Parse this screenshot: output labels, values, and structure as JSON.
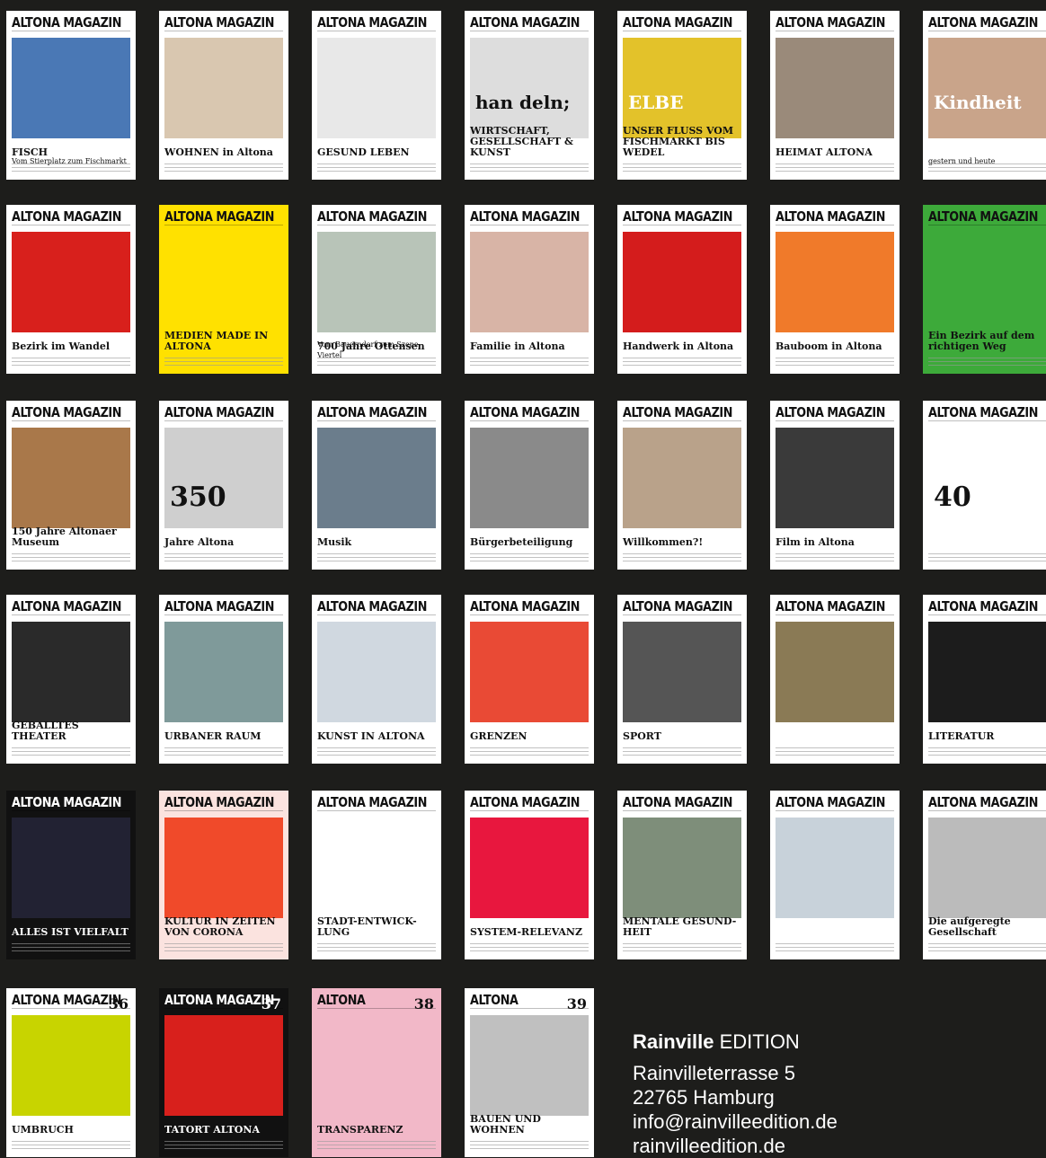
{
  "issues": [
    {
      "masthead": "ALTONA MAGAZIN",
      "headline": "FISCH",
      "sub": "Vom Stierplatz zum Fischmarkt",
      "bg": "#ffffff",
      "art": "#4a78b5"
    },
    {
      "masthead": "ALTONA MAGAZIN",
      "headline": "WOHNEN in Altona",
      "sub": "",
      "bg": "#ffffff",
      "art": "#d9c7b0"
    },
    {
      "masthead": "ALTONA MAGAZIN",
      "headline": "GESUND LEBEN",
      "sub": "",
      "bg": "#ffffff",
      "art": "#e8e8e8"
    },
    {
      "masthead": "ALTONA MAGAZIN",
      "headline": "WIRTSCHAFT, GESELLSCHAFT & KUNST",
      "sub": "",
      "bg": "#ffffff",
      "art": "#dddddd",
      "big": "han deln;"
    },
    {
      "masthead": "ALTONA MAGAZIN",
      "headline": "UNSER FLUSS VOM FISCHMARKT BIS WEDEL",
      "sub": "",
      "bg": "#ffffff",
      "art": "#e3c22a",
      "big": "ELBE"
    },
    {
      "masthead": "ALTONA MAGAZIN",
      "headline": "HEIMAT ALTONA",
      "sub": "",
      "bg": "#ffffff",
      "art": "#9a8a7a"
    },
    {
      "masthead": "ALTONA MAGAZIN",
      "headline": "",
      "sub": "gestern und heute",
      "bg": "#ffffff",
      "art": "#c9a48a",
      "big": "Kindheit"
    },
    {
      "masthead": "ALTONA MAGAZIN",
      "headline": "Bezirk im Wandel",
      "sub": "",
      "bg": "#ffffff",
      "art": "#d8201c"
    },
    {
      "masthead": "ALTONA MAGAZIN",
      "headline": "MEDIEN MADE IN ALTONA",
      "sub": "",
      "bg": "#ffe100",
      "art": "#ffe100"
    },
    {
      "masthead": "ALTONA MAGAZIN",
      "headline": "700 Jahre Ottensen",
      "sub": "Vom Bauerndorf zum Szene-Viertel",
      "bg": "#ffffff",
      "art": "#b8c4b8"
    },
    {
      "masthead": "ALTONA MAGAZIN",
      "headline": "Familie in Altona",
      "sub": "",
      "bg": "#ffffff",
      "art": "#d8b4a6"
    },
    {
      "masthead": "ALTONA MAGAZIN",
      "headline": "Handwerk in Altona",
      "sub": "",
      "bg": "#ffffff",
      "art": "#d41c1c"
    },
    {
      "masthead": "ALTONA MAGAZIN",
      "headline": "Bauboom in Altona",
      "sub": "",
      "bg": "#ffffff",
      "art": "#f07a2a"
    },
    {
      "masthead": "ALTONA MAGAZIN",
      "headline": "Ein Bezirk auf dem richtigen Weg",
      "sub": "",
      "bg": "#3daa3a",
      "art": "#3daa3a"
    },
    {
      "masthead": "ALTONA MAGAZIN",
      "headline": "150 Jahre Altonaer Museum",
      "sub": "",
      "bg": "#ffffff",
      "art": "#a9784a"
    },
    {
      "masthead": "ALTONA MAGAZIN",
      "headline": "Jahre Altona",
      "sub": "",
      "bg": "#ffffff",
      "art": "#cfcfcf",
      "big": "350"
    },
    {
      "masthead": "ALTONA MAGAZIN",
      "headline": "Musik",
      "sub": "",
      "bg": "#ffffff",
      "art": "#6b7d8c"
    },
    {
      "masthead": "ALTONA MAGAZIN",
      "headline": "Bürgerbeteiligung",
      "sub": "",
      "bg": "#ffffff",
      "art": "#8a8a8a"
    },
    {
      "masthead": "ALTONA MAGAZIN",
      "headline": "Willkommen?!",
      "sub": "",
      "bg": "#ffffff",
      "art": "#b9a28a"
    },
    {
      "masthead": "ALTONA MAGAZIN",
      "headline": "Film in Altona",
      "sub": "",
      "bg": "#ffffff",
      "art": "#3a3a3a"
    },
    {
      "masthead": "ALTONA MAGAZIN",
      "headline": "",
      "sub": "",
      "bg": "#ffffff",
      "art": "#ffffff",
      "big": "40"
    },
    {
      "masthead": "ALTONA MAGAZIN",
      "headline": "GEBALLTES THEATER",
      "sub": "",
      "bg": "#ffffff",
      "art": "#2a2a2a"
    },
    {
      "masthead": "ALTONA MAGAZIN",
      "headline": "URBANER RAUM",
      "sub": "",
      "bg": "#ffffff",
      "art": "#7f9a9a"
    },
    {
      "masthead": "ALTONA MAGAZIN",
      "headline": "KUNST IN ALTONA",
      "sub": "",
      "bg": "#ffffff",
      "art": "#d0d8e0"
    },
    {
      "masthead": "ALTONA MAGAZIN",
      "headline": "GRENZEN",
      "sub": "",
      "bg": "#ffffff",
      "art": "#e94a35"
    },
    {
      "masthead": "ALTONA MAGAZIN",
      "headline": "SPORT",
      "sub": "",
      "bg": "#ffffff",
      "art": "#555555"
    },
    {
      "masthead": "ALTONA MAGAZIN",
      "headline": "",
      "sub": "",
      "bg": "#ffffff",
      "art": "#8a7a55"
    },
    {
      "masthead": "ALTONA MAGAZIN",
      "headline": "LITERATUR",
      "sub": "",
      "bg": "#ffffff",
      "art": "#1c1c1c"
    },
    {
      "masthead": "ALTONA MAGAZIN",
      "headline": "ALLES IST VIELFALT",
      "sub": "",
      "bg": "#111111",
      "art": "#222233"
    },
    {
      "masthead": "ALTONA MAGAZIN",
      "headline": "KULTUR IN ZEITEN VON CORONA",
      "sub": "",
      "bg": "#fbe3df",
      "art": "#f04a2a"
    },
    {
      "masthead": "ALTONA MAGAZIN",
      "headline": "STADT-ENTWICK-LUNG",
      "sub": "",
      "bg": "#ffffff",
      "art": "#ffffff"
    },
    {
      "masthead": "ALTONA MAGAZIN",
      "headline": "SYSTEM-RELEVANZ",
      "sub": "",
      "bg": "#ffffff",
      "art": "#e8173e"
    },
    {
      "masthead": "ALTONA MAGAZIN",
      "headline": "MENTALE GESUND-HEIT",
      "sub": "",
      "bg": "#ffffff",
      "art": "#7e8e7a"
    },
    {
      "masthead": "ALTONA MAGAZIN",
      "headline": "",
      "sub": "",
      "bg": "#ffffff",
      "art": "#c8d2da"
    },
    {
      "masthead": "ALTONA MAGAZIN",
      "headline": "Die aufgeregte Gesellschaft",
      "sub": "",
      "bg": "#ffffff",
      "art": "#bbbbbb"
    },
    {
      "masthead": "ALTONA MAGAZIN",
      "headline": "UMBRUCH",
      "sub": "",
      "bg": "#ffffff",
      "art": "#c8d400",
      "num": "36"
    },
    {
      "masthead": "ALTONA MAGAZIN",
      "headline": "TATORT ALTONA",
      "sub": "",
      "bg": "#111111",
      "art": "#d8201c",
      "num": "37"
    },
    {
      "masthead": "ALTONA",
      "headline": "TRANSPARENZ",
      "sub": "",
      "bg": "#f2b8c8",
      "art": "#f2b8c8",
      "num": "38"
    },
    {
      "masthead": "ALTONA",
      "headline": "BAUEN UND WOHNEN",
      "sub": "",
      "bg": "#ffffff",
      "art": "#c0c0c0",
      "num": "39"
    }
  ],
  "imprint": {
    "brand": "Rainville",
    "edition": " EDITION",
    "street": "Rainvilleterrasse 5",
    "city": "22765 Hamburg",
    "email": "info@rainvilleedition.de",
    "web": "rainvilleedition.de"
  }
}
